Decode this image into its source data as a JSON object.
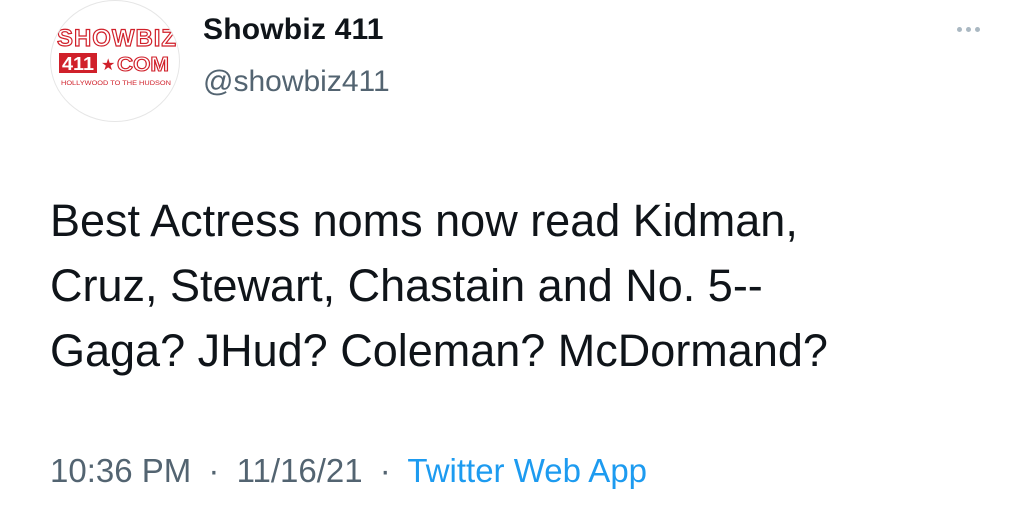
{
  "author": {
    "display_name": "Showbiz 411",
    "handle": "@showbiz411",
    "avatar": {
      "logo_line1": "SHOWBIZ",
      "logo_line2_left": "411",
      "logo_line2_right": "COM",
      "logo_tagline": "HOLLYWOOD TO THE HUDSON",
      "logo_color": "#d0202a"
    }
  },
  "more_icon": "more-horizontal-icon",
  "tweet": {
    "lines": [
      "Best Actress noms now read Kidman,",
      "Cruz, Stewart, Chastain and No. 5--",
      "Gaga? JHud? Coleman? McDormand?"
    ]
  },
  "meta": {
    "time": "10:36 PM",
    "date": "11/16/21",
    "separator": "·",
    "source": "Twitter Web App"
  },
  "colors": {
    "text": "#0f1419",
    "secondary": "#536471",
    "link": "#1d9bf0"
  }
}
